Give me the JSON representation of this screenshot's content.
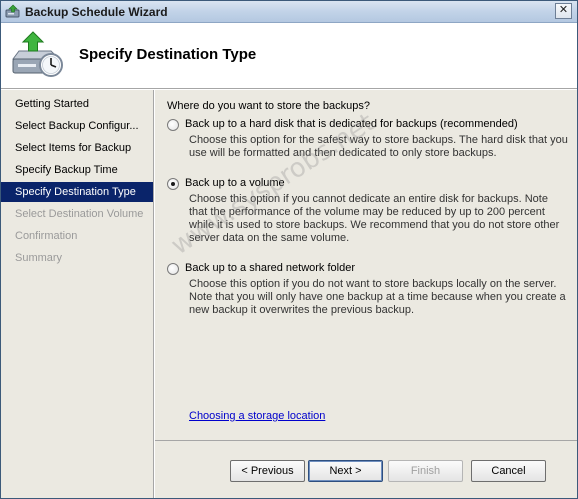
{
  "window": {
    "title": "Backup Schedule Wizard",
    "close_glyph": "✕",
    "title_icon": "server-backup-icon"
  },
  "header": {
    "title": "Specify Destination Type",
    "icon": "backup-schedule-clock-icon"
  },
  "nav": {
    "items": [
      {
        "label": "Getting Started",
        "state": "normal"
      },
      {
        "label": "Select Backup Configur...",
        "state": "normal"
      },
      {
        "label": "Select Items for Backup",
        "state": "normal"
      },
      {
        "label": "Specify Backup Time",
        "state": "normal"
      },
      {
        "label": "Specify Destination Type",
        "state": "active"
      },
      {
        "label": "Select Destination Volume",
        "state": "disabled"
      },
      {
        "label": "Confirmation",
        "state": "disabled"
      },
      {
        "label": "Summary",
        "state": "disabled"
      }
    ]
  },
  "main": {
    "question": "Where do you want to store the backups?",
    "options": [
      {
        "label": "Back up to a hard disk that is dedicated for backups (recommended)",
        "description": "Choose this option for the safest way to store backups. The hard disk that you use will be formatted and then dedicated to only store backups.",
        "checked": false
      },
      {
        "label": "Back up to a volume",
        "description": "Choose this option if you cannot dedicate an entire disk for backups. Note that the performance of the volume may be reduced by up to 200 percent while it is used to store backups. We recommend that you do not store other server data on the same volume.",
        "checked": true
      },
      {
        "label": "Back up to a shared network folder",
        "description": "Choose this option if you do not want to store backups locally on the server. Note that you will only have one backup at a time because when you create a new backup it overwrites the previous backup.",
        "checked": false
      }
    ],
    "link": "Choosing a storage location",
    "watermark": "www.sysprobs.net"
  },
  "footer": {
    "previous": "< Previous",
    "next": "Next >",
    "finish": "Finish",
    "cancel": "Cancel"
  },
  "colors": {
    "nav_active_bg": "#0a246a",
    "panel_bg": "#ebe9e1",
    "link": "#0000cc"
  }
}
